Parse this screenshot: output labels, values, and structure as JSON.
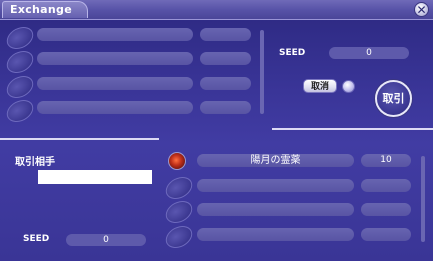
{
  "window": {
    "title": "Exchange"
  },
  "my_offer": {
    "slots": [
      {
        "name": "",
        "qty": ""
      },
      {
        "name": "",
        "qty": ""
      },
      {
        "name": "",
        "qty": ""
      },
      {
        "name": "",
        "qty": ""
      }
    ],
    "seed_label": "SEED",
    "seed_value": "0",
    "cancel_label": "取消",
    "trade_label": "取引"
  },
  "partner": {
    "label": "取引相手",
    "name": "",
    "slots": [
      {
        "name": "陽月の霊薬",
        "qty": "10",
        "icon": "item-orb-icon"
      },
      {
        "name": "",
        "qty": ""
      },
      {
        "name": "",
        "qty": ""
      },
      {
        "name": "",
        "qty": ""
      }
    ],
    "seed_label": "SEED",
    "seed_value": "0"
  },
  "colors": {
    "background": "#3a3598",
    "bar": "#5e5aab",
    "accent": "#ffffff"
  }
}
